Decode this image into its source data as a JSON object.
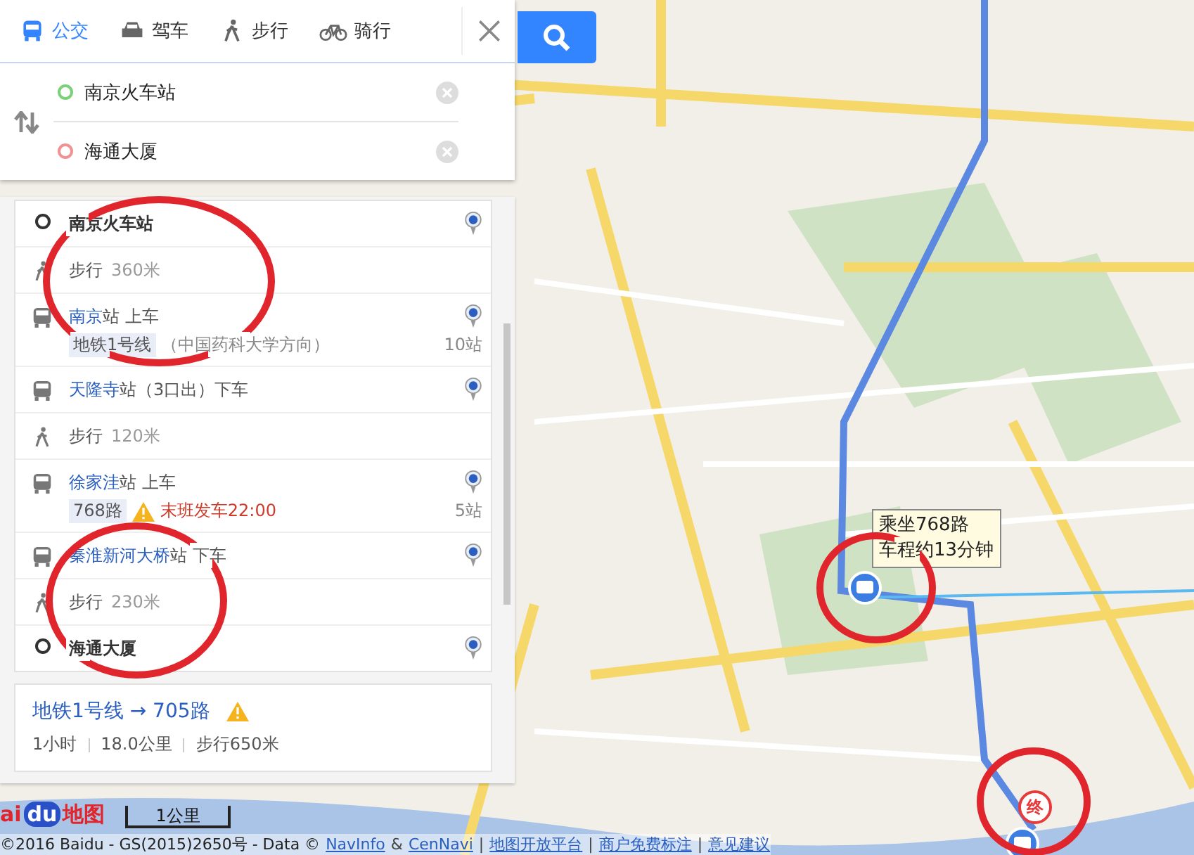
{
  "tabs": [
    {
      "label": "公交",
      "kind": "bus",
      "selected": true
    },
    {
      "label": "驾车",
      "kind": "car",
      "selected": false
    },
    {
      "label": "步行",
      "kind": "walk",
      "selected": false
    },
    {
      "label": "骑行",
      "kind": "bike",
      "selected": false
    }
  ],
  "from": {
    "value": "南京火车站"
  },
  "to": {
    "value": "海通大厦"
  },
  "steps": [
    {
      "kind": "start",
      "name": "南京火车站"
    },
    {
      "kind": "walk",
      "label": "步行",
      "distance": "360米"
    },
    {
      "kind": "board",
      "station": "南京",
      "suffix": "站 上车",
      "line": "地铁1号线",
      "direction": "（中国药科大学方向）",
      "stops": "10站"
    },
    {
      "kind": "alight",
      "station": "天隆寺",
      "suffix": "站（3口出）下车"
    },
    {
      "kind": "walk",
      "label": "步行",
      "distance": "120米"
    },
    {
      "kind": "board",
      "station": "徐家洼",
      "suffix": "站 上车",
      "line": "768路",
      "warning": "末班发车22:00",
      "stops": "5站"
    },
    {
      "kind": "alight",
      "station": "秦淮新河大桥",
      "suffix": "站 下车"
    },
    {
      "kind": "walk",
      "label": "步行",
      "distance": "230米"
    },
    {
      "kind": "end",
      "name": "海通大厦"
    }
  ],
  "alternative": {
    "title": "地铁1号线 → 705路",
    "warning": true,
    "stats": [
      "1小时",
      "18.0公里",
      "步行650米"
    ]
  },
  "tooltip": {
    "lines": [
      "乘坐768路",
      "车程约13分钟"
    ]
  },
  "end_marker": "终",
  "logo": {
    "parts": [
      "ai",
      "du",
      "地图"
    ]
  },
  "scale": "1公里",
  "footer": {
    "copyright": "©2016 Baidu - GS(2015)2650号 - Data ©",
    "amp": "&",
    "separator": "|",
    "links": [
      "NavInfo",
      "CenNavi",
      "地图开放平台",
      "商户免费标注",
      "意见建议"
    ]
  }
}
